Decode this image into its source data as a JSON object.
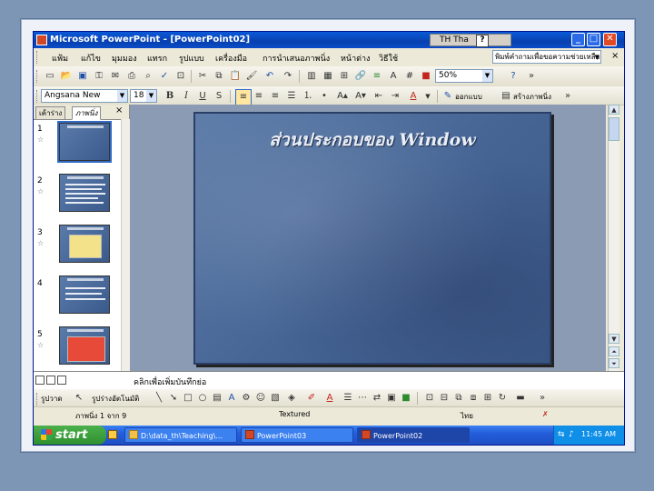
{
  "window": {
    "title": "Microsoft PowerPoint - [PowerPoint02]",
    "language_indicator": "TH Tha",
    "help_button": "?",
    "buttons": {
      "minimize": "_",
      "maximize": "□",
      "close": "✕"
    }
  },
  "menubar": {
    "items": [
      "แฟ้ม",
      "แก้ไข",
      "มุมมอง",
      "แทรก",
      "รูปแบบ",
      "เครื่องมือ",
      "การนำเสนอภาพนิ่ง",
      "หน้าต่าง",
      "วิธีใช้"
    ],
    "question_box_placeholder": "พิมพ์คำถามเพื่อขอความช่วยเหลือ",
    "doc_close": "×"
  },
  "toolbar_standard": {
    "zoom": "50%"
  },
  "toolbar_formatting": {
    "font_name": "Angsana New",
    "font_size": "18",
    "bold": "B",
    "italic": "I",
    "underline": "U",
    "shadow": "S",
    "design_label": "ออกแบบ",
    "new_slide_label": "สร้างภาพนิ่ง"
  },
  "side_panel": {
    "tabs": [
      "เค้าร่าง",
      "ภาพนิ่ง"
    ],
    "close": "×",
    "slide_numbers": [
      "1",
      "2",
      "3",
      "4",
      "5"
    ]
  },
  "slide": {
    "title": "ส่วนประกอบของ Window"
  },
  "notes": {
    "placeholder": "คลิกเพื่อเพิ่มบันทึกย่อ"
  },
  "draw_toolbar": {
    "draw_label": "รูปวาด",
    "autoshapes_label": "รูปร่างอัตโนมัติ"
  },
  "status_bar": {
    "slide_position": "ภาพนิ่ง 1 จาก 9",
    "design": "Textured",
    "language": "ไทย"
  },
  "taskbar": {
    "start_label": "start",
    "tasks": [
      "D:\\data_th\\Teaching\\...",
      "PowerPoint03",
      "PowerPoint02"
    ],
    "clock": "11:45 AM"
  },
  "colors": {
    "background": "#7e96b6",
    "titlebar": "#0a5ad8",
    "slide_background": "#4a6796",
    "taskbar": "#245edb",
    "start_button": "#2f8f2f"
  }
}
